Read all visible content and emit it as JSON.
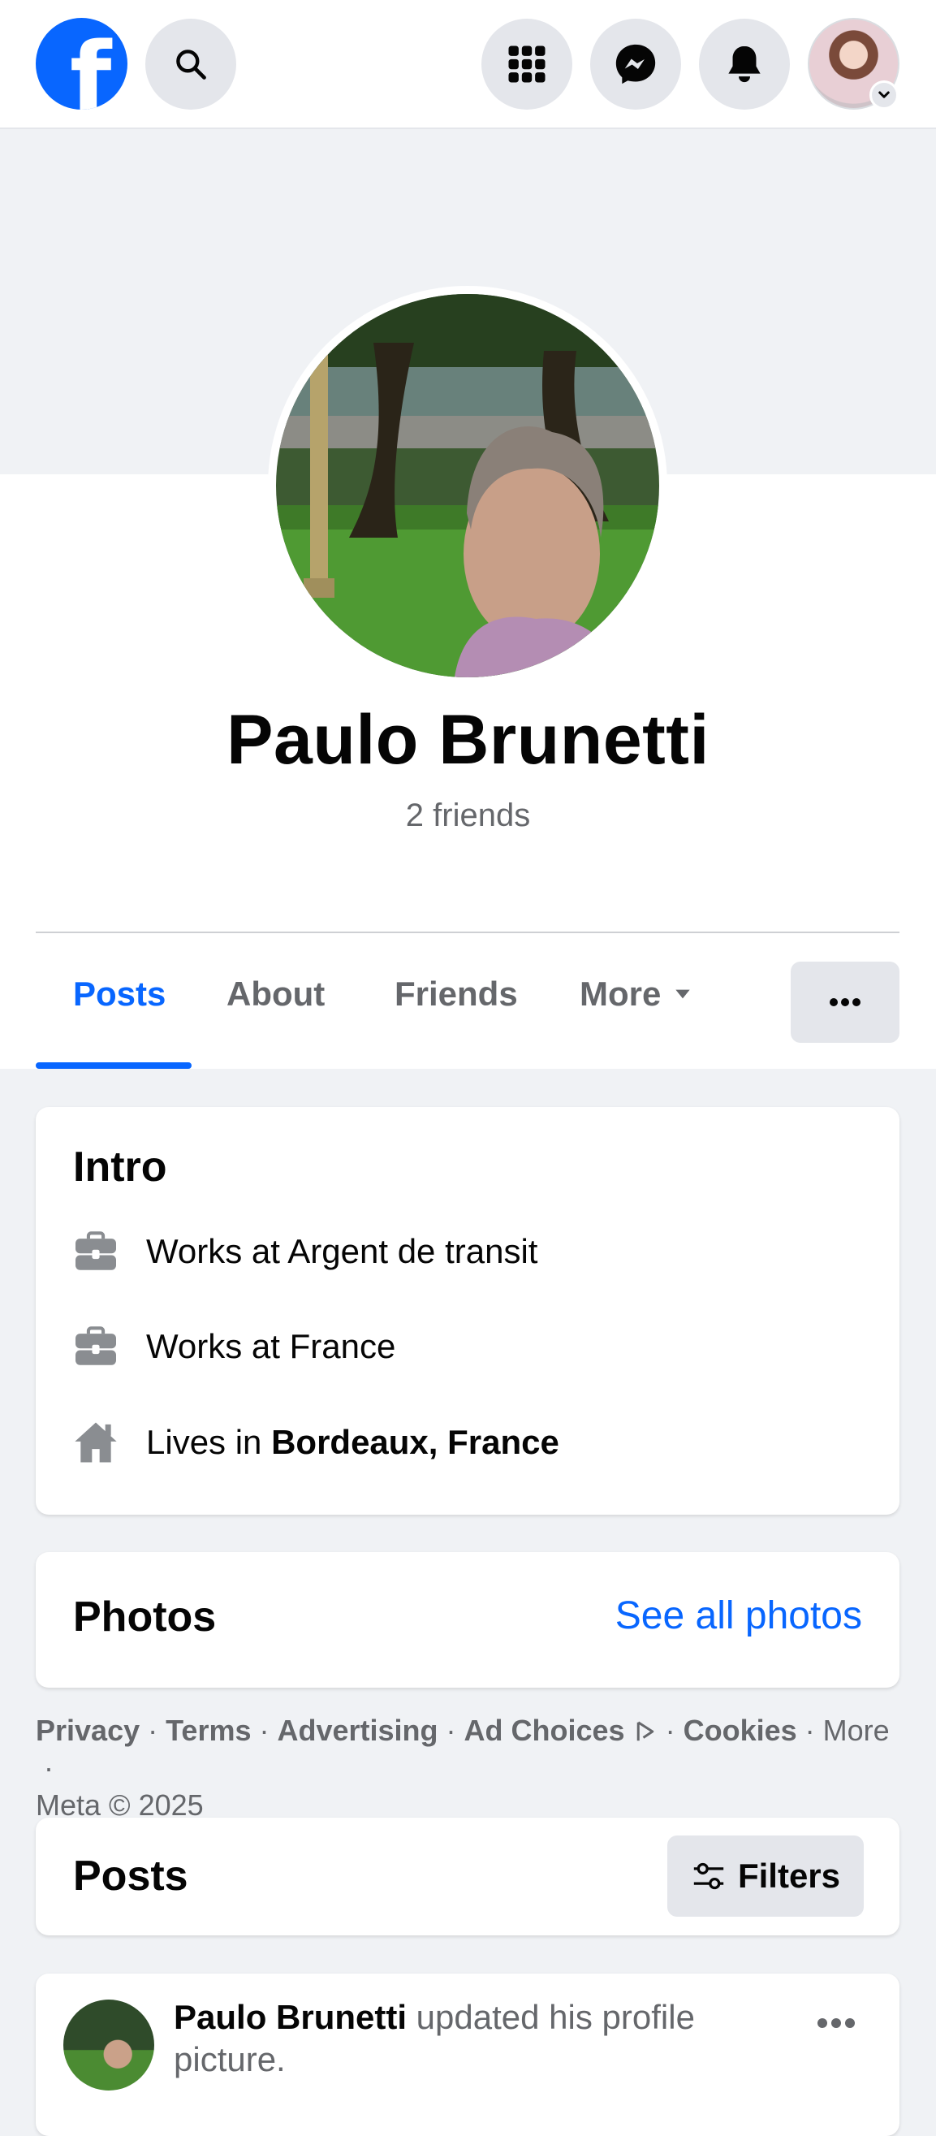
{
  "topbar": {
    "logo_letter": "f",
    "icons": [
      "facebook-logo",
      "search-icon",
      "menu-grid-icon",
      "messenger-icon",
      "bell-icon",
      "account-avatar"
    ]
  },
  "profile": {
    "name": "Paulo Brunetti",
    "friends": "2 friends"
  },
  "tabs": [
    {
      "label": "Posts",
      "active": true
    },
    {
      "label": "About"
    },
    {
      "label": "Friends"
    },
    {
      "label": "More"
    }
  ],
  "intro": {
    "title": "Intro",
    "items": [
      {
        "icon": "briefcase-icon",
        "text": "Works at Argent de transit"
      },
      {
        "icon": "briefcase-icon",
        "text": "Works at France"
      },
      {
        "icon": "home-icon",
        "prefix": "Lives in ",
        "bold": "Bordeaux, France"
      }
    ]
  },
  "photos": {
    "title": "Photos",
    "see_all": "See all photos"
  },
  "footer": {
    "privacy": "Privacy",
    "terms": "Terms",
    "advertising": "Advertising",
    "ad_choices": "Ad Choices",
    "cookies": "Cookies",
    "more": "More",
    "copyright": "Meta © 2025",
    "sep": " · "
  },
  "posts": {
    "title": "Posts",
    "filters": "Filters",
    "first_post": {
      "author": "Paulo Brunetti",
      "action": " updated his profile picture."
    }
  },
  "colors": {
    "accent": "#0866ff",
    "secondary_text": "#65676b",
    "background": "#f0f2f5"
  }
}
